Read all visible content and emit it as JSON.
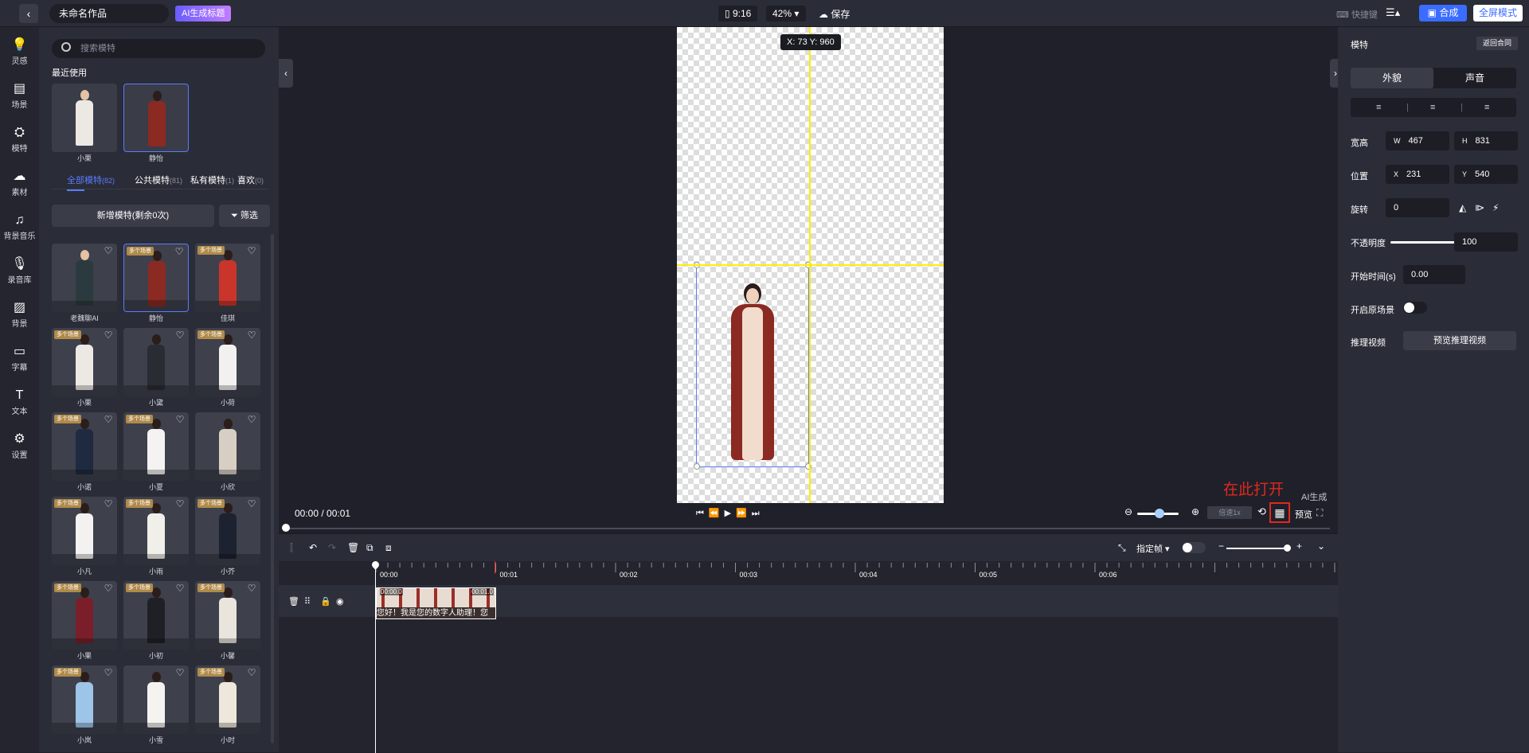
{
  "topbar": {
    "back_glyph": "‹",
    "project_title": "未命名作品",
    "ai_title_btn": "AI生成标题",
    "ratio": "9:16",
    "zoom": "42%",
    "save": "保存",
    "shortcut": "快捷键",
    "compose": "合成",
    "fullscreen_mode": "全屏模式"
  },
  "nav": [
    {
      "label": "灵感",
      "icon": "bulb-icon"
    },
    {
      "label": "场景",
      "icon": "scene-icon"
    },
    {
      "label": "模特",
      "icon": "model-icon"
    },
    {
      "label": "素材",
      "icon": "cloud-icon"
    },
    {
      "label": "背景音乐",
      "icon": "music-icon"
    },
    {
      "label": "录音库",
      "icon": "mic-icon"
    },
    {
      "label": "背景",
      "icon": "background-icon"
    },
    {
      "label": "字幕",
      "icon": "subtitle-icon"
    },
    {
      "label": "文本",
      "icon": "text-icon"
    },
    {
      "label": "设置",
      "icon": "gear-icon"
    }
  ],
  "library": {
    "search_placeholder": "搜索模特",
    "recent_title": "最近使用",
    "recent": [
      {
        "name": "小栗"
      },
      {
        "name": "静怡"
      }
    ],
    "tabs": [
      {
        "label": "全部模特",
        "count": "(82)"
      },
      {
        "label": "公共模特",
        "count": "(81)"
      },
      {
        "label": "私有模特",
        "count": "(1)"
      },
      {
        "label": "喜欢",
        "count": "(0)"
      }
    ],
    "add_model": "新增模特(剩余0次)",
    "filter": "筛选",
    "badge_text": "多个场景",
    "models": [
      {
        "name": "老魏聊AI"
      },
      {
        "name": "静怡"
      },
      {
        "name": "佳琪"
      },
      {
        "name": "小栗"
      },
      {
        "name": "小黛"
      },
      {
        "name": "小荷"
      },
      {
        "name": "小诺"
      },
      {
        "name": "小夏"
      },
      {
        "name": "小欣"
      },
      {
        "name": "小凡"
      },
      {
        "name": "小雨"
      },
      {
        "name": "小芥"
      },
      {
        "name": "小果"
      },
      {
        "name": "小初"
      },
      {
        "name": "小馨"
      },
      {
        "name": "小岚"
      },
      {
        "name": "小雪"
      },
      {
        "name": "小时"
      }
    ]
  },
  "canvas": {
    "coord_tip": "X: 73 Y: 960",
    "time": "00:00 / 00:01",
    "speed": "倍速1x",
    "annotation": "在此打开",
    "ai_gen": "AI生成",
    "preview": "预览"
  },
  "timeline": {
    "specify_frame": "指定帧",
    "ticks": [
      "00:00",
      "00:01",
      "00:02",
      "00:03",
      "00:04",
      "00:05",
      "00:06"
    ],
    "clip_start": "00:00.0",
    "clip_end": "00:01.0",
    "clip_text": "您好！我是您的数字人助理！您"
  },
  "right": {
    "title": "模特",
    "back": "返回合同",
    "tab_look": "外貌",
    "tab_voice": "声音",
    "size_label": "宽高",
    "w_prefix": "W",
    "w": "467",
    "h_prefix": "H",
    "h": "831",
    "pos_label": "位置",
    "x_prefix": "X",
    "x": "231",
    "y_prefix": "Y",
    "y": "540",
    "rotate_label": "旋转",
    "rotate": "0",
    "opacity_label": "不透明度",
    "opacity": "100",
    "start_label": "开始时间(s)",
    "start": "0.00",
    "orig_scene_label": "开启原场景",
    "infer_label": "推理视频",
    "infer_btn": "预览推理视频"
  }
}
